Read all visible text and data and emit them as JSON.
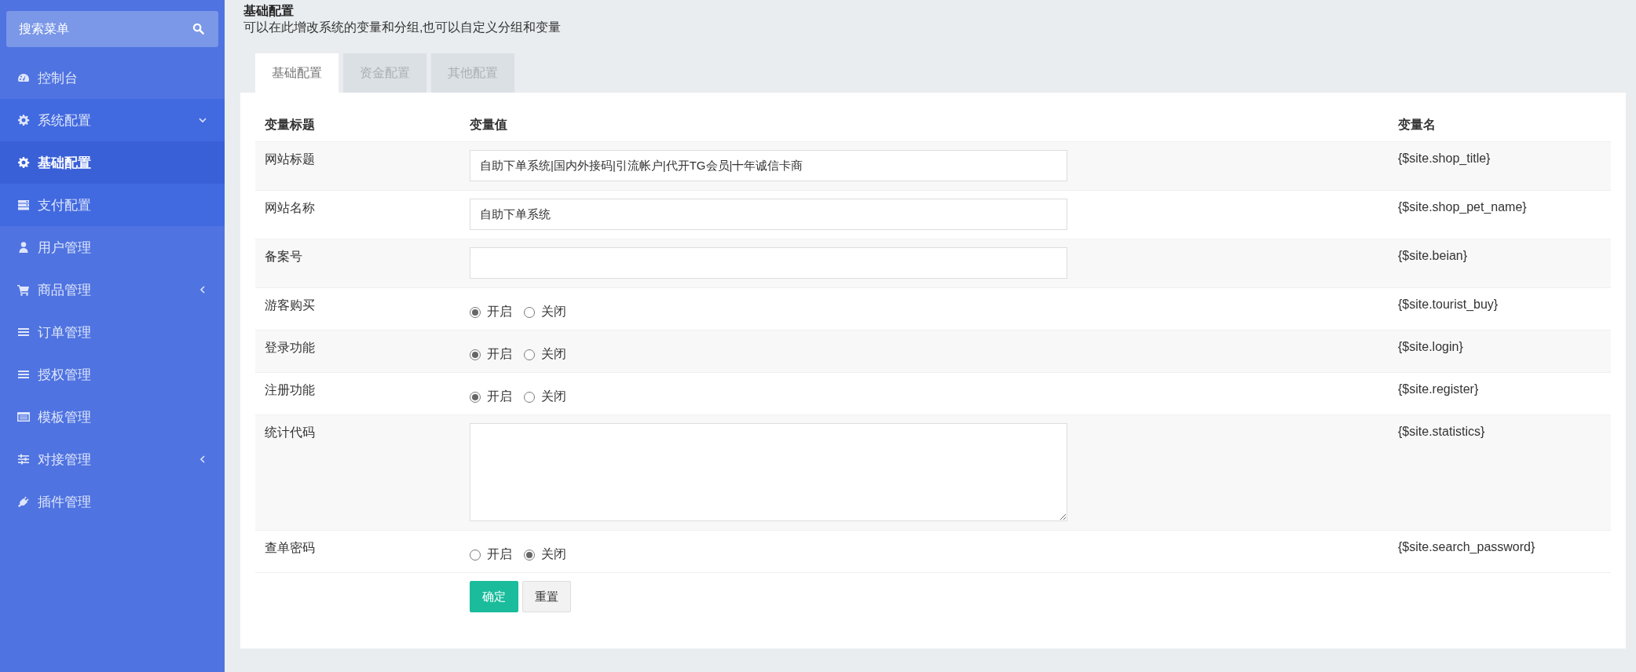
{
  "sidebar": {
    "search": {
      "placeholder": "搜索菜单"
    },
    "items": [
      {
        "label": "控制台",
        "selected": false
      },
      {
        "label": "系统配置",
        "selected": false,
        "expanded": true,
        "children": [
          {
            "label": "基础配置",
            "selected": true
          },
          {
            "label": "支付配置",
            "selected": false
          }
        ]
      },
      {
        "label": "用户管理",
        "selected": false
      },
      {
        "label": "商品管理",
        "selected": false,
        "expanded": false
      },
      {
        "label": "订单管理",
        "selected": false
      },
      {
        "label": "授权管理",
        "selected": false
      },
      {
        "label": "模板管理",
        "selected": false
      },
      {
        "label": "对接管理",
        "selected": false,
        "expanded": false
      },
      {
        "label": "插件管理",
        "selected": false
      }
    ]
  },
  "header": {
    "title": "基础配置",
    "subtitle": "可以在此增改系统的变量和分组,也可以自定义分组和变量"
  },
  "tabs": [
    {
      "label": "基础配置",
      "selected": true
    },
    {
      "label": "资金配置",
      "selected": false
    },
    {
      "label": "其他配置",
      "selected": false
    }
  ],
  "table": {
    "columns": [
      "变量标题",
      "变量值",
      "变量名"
    ],
    "rows": [
      {
        "kind": "text",
        "label": "网站标题",
        "value": "自助下单系统|国内外接码|引流帐户|代开TG会员|十年诚信卡商",
        "variable": "{$site.shop_title}"
      },
      {
        "kind": "text",
        "label": "网站名称",
        "value": "自助下单系统",
        "variable": "{$site.shop_pet_name}"
      },
      {
        "kind": "text",
        "label": "备案号",
        "variable": "{$site.beian}"
      },
      {
        "kind": "radio",
        "label": "游客购买",
        "options": [
          {
            "label": "开启",
            "selected": true
          },
          {
            "label": "关闭",
            "selected": false
          }
        ],
        "variable": "{$site.tourist_buy}"
      },
      {
        "kind": "radio",
        "label": "登录功能",
        "options": [
          {
            "label": "开启",
            "selected": true
          },
          {
            "label": "关闭",
            "selected": false
          }
        ],
        "variable": "{$site.login}"
      },
      {
        "kind": "radio",
        "label": "注册功能",
        "options": [
          {
            "label": "开启",
            "selected": true
          },
          {
            "label": "关闭",
            "selected": false
          }
        ],
        "variable": "{$site.register}"
      },
      {
        "kind": "textarea",
        "label": "统计代码",
        "variable": "{$site.statistics}"
      },
      {
        "kind": "radio",
        "label": "查单密码",
        "options": [
          {
            "label": "开启",
            "selected": false
          },
          {
            "label": "关闭",
            "selected": true
          }
        ],
        "variable": "{$site.search_password}"
      }
    ]
  },
  "buttons": [
    {
      "kind": "primary",
      "label": "确定"
    },
    {
      "kind": "default",
      "label": "重置"
    }
  ]
}
